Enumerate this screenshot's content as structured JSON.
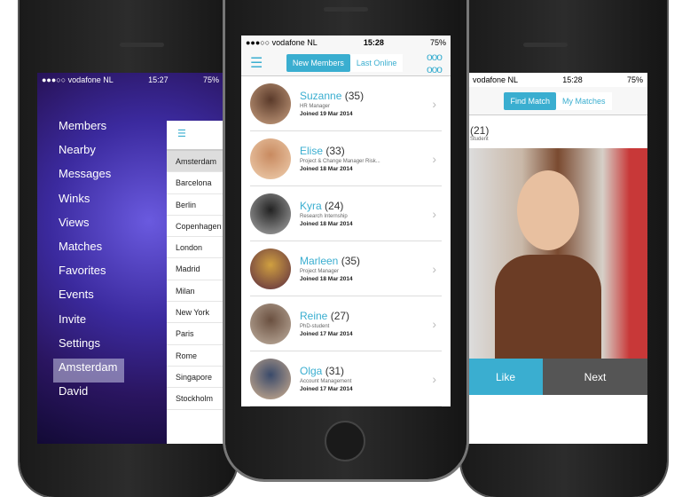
{
  "left": {
    "status": {
      "carrier": "●●●○○ vodafone NL",
      "time": "15:27",
      "battery": "75%"
    },
    "menu": [
      "Members",
      "Nearby",
      "Messages",
      "Winks",
      "Views",
      "Matches",
      "Favorites",
      "Events",
      "Invite",
      "Settings",
      "Amsterdam",
      "David"
    ],
    "selected_menu": "Amsterdam",
    "cities": [
      "Amsterdam",
      "Barcelona",
      "Berlin",
      "Copenhagen",
      "London",
      "Madrid",
      "Milan",
      "New York",
      "Paris",
      "Rome",
      "Singapore",
      "Stockholm"
    ],
    "selected_city": "Amsterdam"
  },
  "middle": {
    "status": {
      "carrier": "●●●○○ vodafone NL",
      "time": "15:28",
      "battery": "75%"
    },
    "tabs": [
      "New Members",
      "Last Online"
    ],
    "active_tab": "New Members",
    "members": [
      {
        "name": "Suzanne",
        "age": "(35)",
        "job": "HR Manager",
        "joined": "Joined 19 Mar 2014"
      },
      {
        "name": "Elise",
        "age": "(33)",
        "job": "Project & Change Manager Risk...",
        "joined": "Joined 18 Mar 2014"
      },
      {
        "name": "Kyra",
        "age": "(24)",
        "job": "Research Internship",
        "joined": "Joined 18 Mar 2014"
      },
      {
        "name": "Marleen",
        "age": "(35)",
        "job": "Project Manager",
        "joined": "Joined 18 Mar 2014"
      },
      {
        "name": "Reine",
        "age": "(27)",
        "job": "PhD-student",
        "joined": "Joined 17 Mar 2014"
      },
      {
        "name": "Olga",
        "age": "(31)",
        "job": "Account Management",
        "joined": "Joined 17 Mar 2014"
      }
    ]
  },
  "right": {
    "status": {
      "carrier": "vodafone NL",
      "time": "15:28",
      "battery": "75%"
    },
    "tabs": [
      "Find Match",
      "My Matches"
    ],
    "active_tab": "Find Match",
    "profile": {
      "age": "(21)",
      "job": "Student"
    },
    "like_label": "Like",
    "next_label": "Next"
  },
  "colors": {
    "accent": "#3aaed0",
    "next_button": "#555555"
  }
}
